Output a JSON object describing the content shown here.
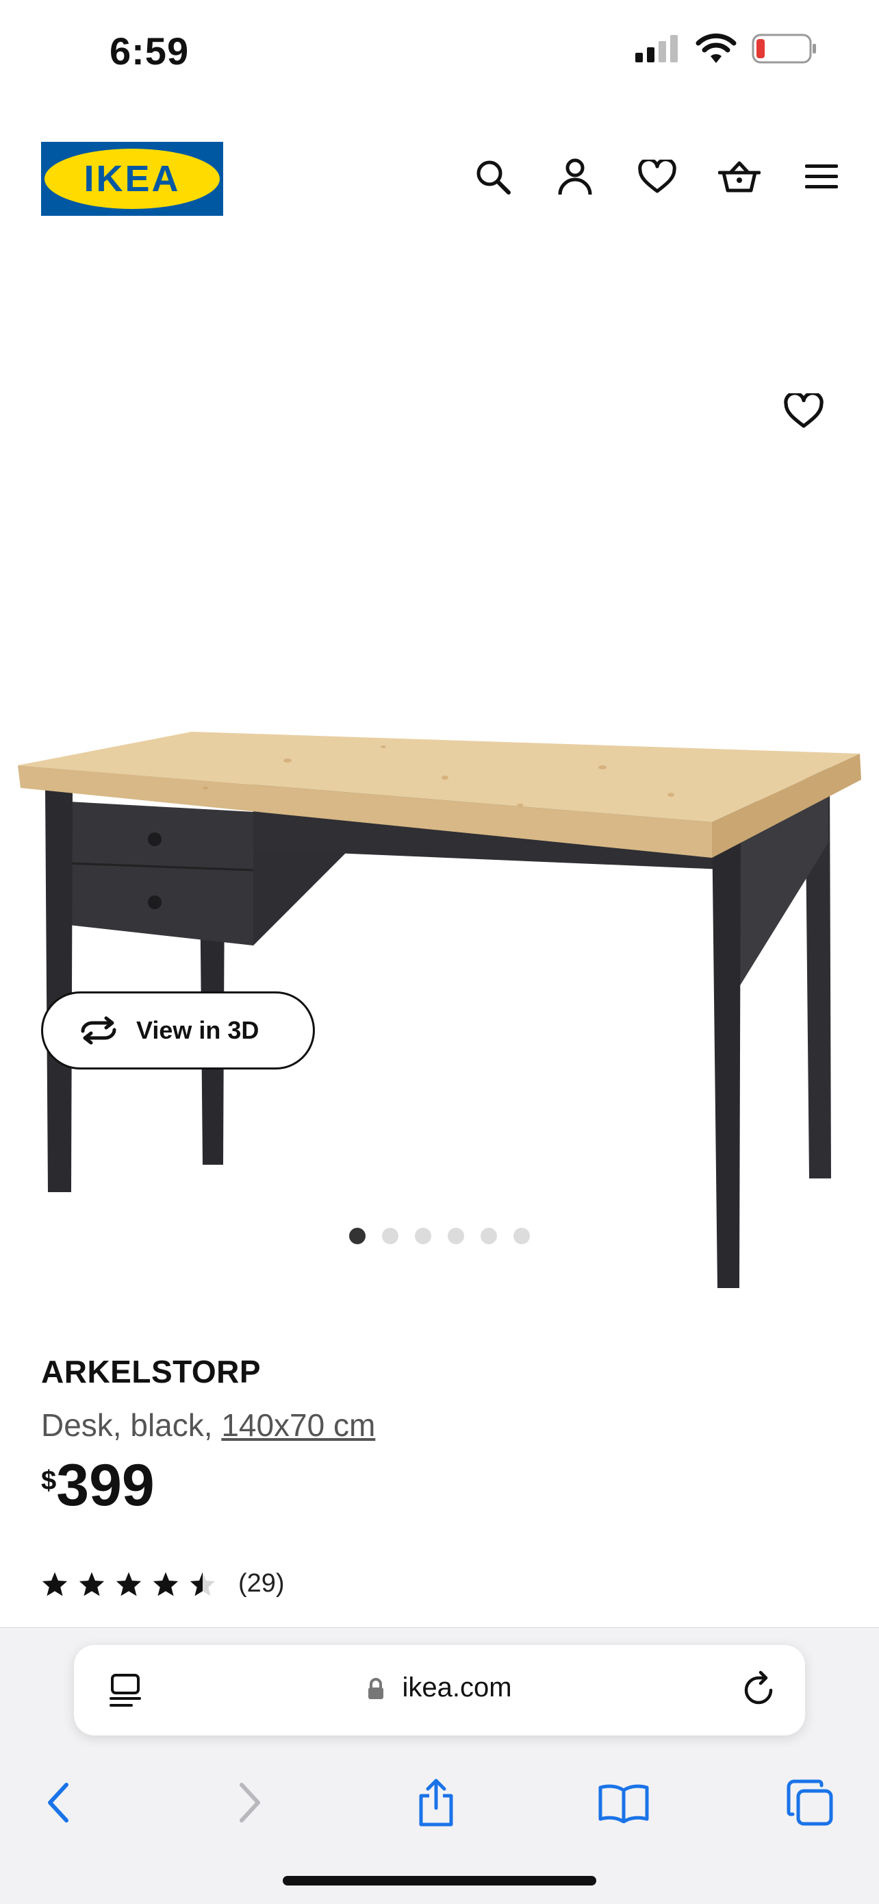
{
  "status_bar": {
    "time": "6:59"
  },
  "header": {
    "logo_text": "IKEA",
    "icons": [
      "search-icon",
      "account-icon",
      "heart-icon",
      "basket-icon",
      "menu-icon"
    ]
  },
  "product": {
    "gallery": {
      "total_images": 6,
      "active_index": 0,
      "view3d_label": "View in 3D"
    },
    "name": "ARKELSTORP",
    "description": "Desk, black,",
    "size": "140x70 cm",
    "price_currency": "$",
    "price": "399",
    "rating": {
      "value": 4.5,
      "max": 5,
      "count": "(29)"
    }
  },
  "browser": {
    "url": "ikea.com",
    "toolbar_icons": [
      "back-icon",
      "forward-icon",
      "share-icon",
      "bookmarks-icon",
      "tabs-icon"
    ]
  },
  "colors": {
    "ikea_blue": "#0058A3",
    "ikea_yellow": "#FFDB00",
    "safari_blue": "#1a73e8"
  }
}
